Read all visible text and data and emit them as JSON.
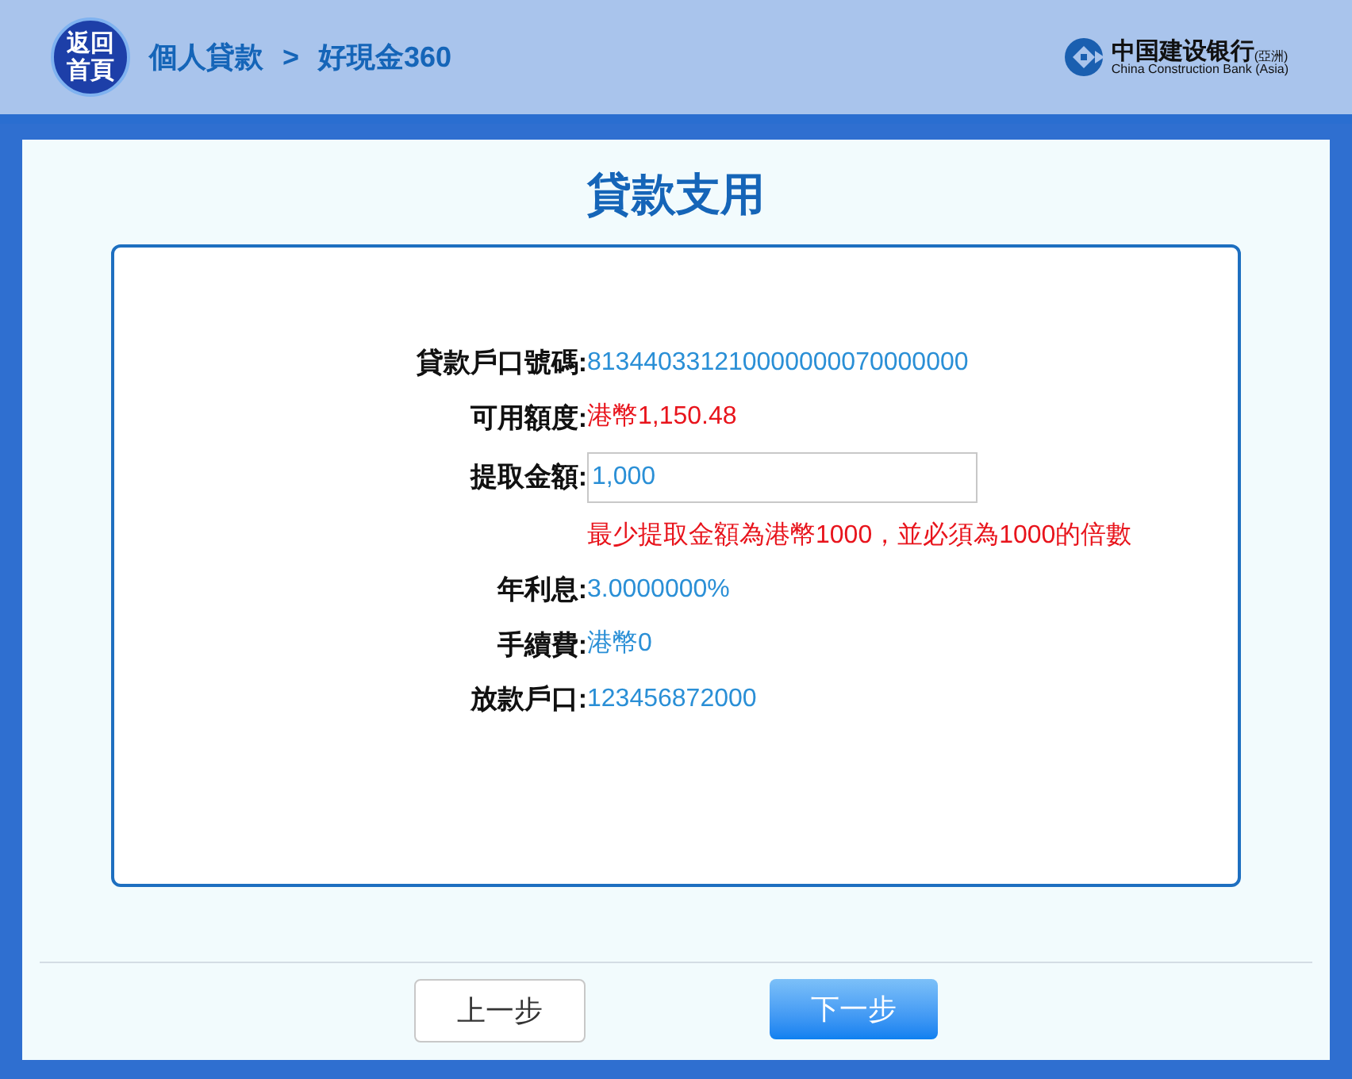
{
  "header": {
    "home_button": [
      "返回",
      "首頁"
    ],
    "breadcrumb": [
      "個人貸款",
      "好現金360"
    ],
    "separator": ">",
    "logo": {
      "name": "中国建设银行",
      "suffix": "(亞洲)",
      "english": "China Construction Bank (Asia)"
    }
  },
  "page_title": "貸款支用",
  "rows": [
    {
      "kind": "text",
      "label": "貸款戶口號碼:",
      "value": "813440331210000000070000000",
      "color": "#2a8fd6"
    },
    {
      "kind": "text",
      "label": "可用額度:",
      "value": "港幣1,150.48",
      "color": "#e8141c"
    },
    {
      "kind": "input",
      "label": "提取金額:",
      "value": "1,000",
      "color": "#2a8fd6"
    },
    {
      "kind": "note",
      "value": "最少提取金額為港幣1000，並必須為1000的倍數",
      "color": "#e8141c"
    },
    {
      "kind": "text",
      "label": "年利息:",
      "value": "3.0000000%",
      "color": "#2a8fd6"
    },
    {
      "kind": "text",
      "label": "手續費:",
      "value": "港幣0",
      "color": "#2a8fd6"
    },
    {
      "kind": "text",
      "label": "放款戶口:",
      "value": "123456872000",
      "color": "#2a8fd6"
    }
  ],
  "buttons": [
    {
      "label": "上一步",
      "kind": "secondary"
    },
    {
      "label": "下一步",
      "kind": "primary"
    }
  ]
}
